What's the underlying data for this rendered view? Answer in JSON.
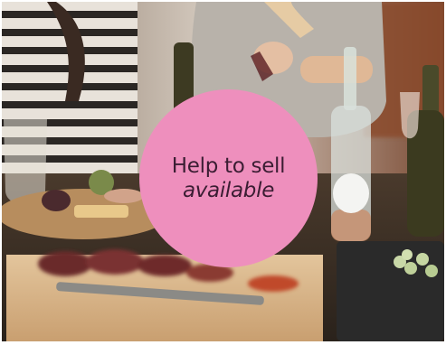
{
  "badge": {
    "title": "Help to sell",
    "subtitle": "available",
    "color": "#ee8fbd",
    "text_color": "#3b1d33"
  }
}
